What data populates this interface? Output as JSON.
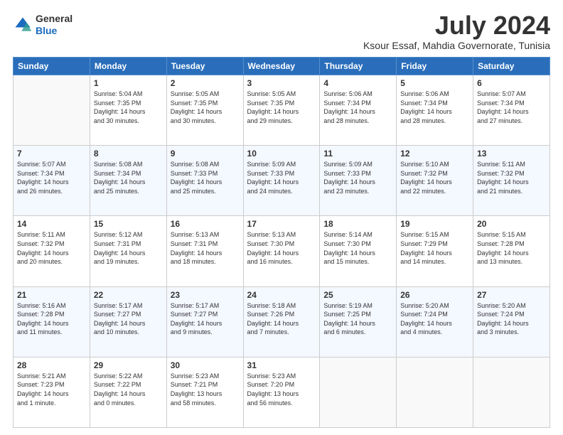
{
  "logo": {
    "general": "General",
    "blue": "Blue"
  },
  "header": {
    "month": "July 2024",
    "location": "Ksour Essaf, Mahdia Governorate, Tunisia"
  },
  "weekdays": [
    "Sunday",
    "Monday",
    "Tuesday",
    "Wednesday",
    "Thursday",
    "Friday",
    "Saturday"
  ],
  "weeks": [
    [
      {
        "day": "",
        "info": ""
      },
      {
        "day": "1",
        "info": "Sunrise: 5:04 AM\nSunset: 7:35 PM\nDaylight: 14 hours\nand 30 minutes."
      },
      {
        "day": "2",
        "info": "Sunrise: 5:05 AM\nSunset: 7:35 PM\nDaylight: 14 hours\nand 30 minutes."
      },
      {
        "day": "3",
        "info": "Sunrise: 5:05 AM\nSunset: 7:35 PM\nDaylight: 14 hours\nand 29 minutes."
      },
      {
        "day": "4",
        "info": "Sunrise: 5:06 AM\nSunset: 7:34 PM\nDaylight: 14 hours\nand 28 minutes."
      },
      {
        "day": "5",
        "info": "Sunrise: 5:06 AM\nSunset: 7:34 PM\nDaylight: 14 hours\nand 28 minutes."
      },
      {
        "day": "6",
        "info": "Sunrise: 5:07 AM\nSunset: 7:34 PM\nDaylight: 14 hours\nand 27 minutes."
      }
    ],
    [
      {
        "day": "7",
        "info": "Sunrise: 5:07 AM\nSunset: 7:34 PM\nDaylight: 14 hours\nand 26 minutes."
      },
      {
        "day": "8",
        "info": "Sunrise: 5:08 AM\nSunset: 7:34 PM\nDaylight: 14 hours\nand 25 minutes."
      },
      {
        "day": "9",
        "info": "Sunrise: 5:08 AM\nSunset: 7:33 PM\nDaylight: 14 hours\nand 25 minutes."
      },
      {
        "day": "10",
        "info": "Sunrise: 5:09 AM\nSunset: 7:33 PM\nDaylight: 14 hours\nand 24 minutes."
      },
      {
        "day": "11",
        "info": "Sunrise: 5:09 AM\nSunset: 7:33 PM\nDaylight: 14 hours\nand 23 minutes."
      },
      {
        "day": "12",
        "info": "Sunrise: 5:10 AM\nSunset: 7:32 PM\nDaylight: 14 hours\nand 22 minutes."
      },
      {
        "day": "13",
        "info": "Sunrise: 5:11 AM\nSunset: 7:32 PM\nDaylight: 14 hours\nand 21 minutes."
      }
    ],
    [
      {
        "day": "14",
        "info": "Sunrise: 5:11 AM\nSunset: 7:32 PM\nDaylight: 14 hours\nand 20 minutes."
      },
      {
        "day": "15",
        "info": "Sunrise: 5:12 AM\nSunset: 7:31 PM\nDaylight: 14 hours\nand 19 minutes."
      },
      {
        "day": "16",
        "info": "Sunrise: 5:13 AM\nSunset: 7:31 PM\nDaylight: 14 hours\nand 18 minutes."
      },
      {
        "day": "17",
        "info": "Sunrise: 5:13 AM\nSunset: 7:30 PM\nDaylight: 14 hours\nand 16 minutes."
      },
      {
        "day": "18",
        "info": "Sunrise: 5:14 AM\nSunset: 7:30 PM\nDaylight: 14 hours\nand 15 minutes."
      },
      {
        "day": "19",
        "info": "Sunrise: 5:15 AM\nSunset: 7:29 PM\nDaylight: 14 hours\nand 14 minutes."
      },
      {
        "day": "20",
        "info": "Sunrise: 5:15 AM\nSunset: 7:28 PM\nDaylight: 14 hours\nand 13 minutes."
      }
    ],
    [
      {
        "day": "21",
        "info": "Sunrise: 5:16 AM\nSunset: 7:28 PM\nDaylight: 14 hours\nand 11 minutes."
      },
      {
        "day": "22",
        "info": "Sunrise: 5:17 AM\nSunset: 7:27 PM\nDaylight: 14 hours\nand 10 minutes."
      },
      {
        "day": "23",
        "info": "Sunrise: 5:17 AM\nSunset: 7:27 PM\nDaylight: 14 hours\nand 9 minutes."
      },
      {
        "day": "24",
        "info": "Sunrise: 5:18 AM\nSunset: 7:26 PM\nDaylight: 14 hours\nand 7 minutes."
      },
      {
        "day": "25",
        "info": "Sunrise: 5:19 AM\nSunset: 7:25 PM\nDaylight: 14 hours\nand 6 minutes."
      },
      {
        "day": "26",
        "info": "Sunrise: 5:20 AM\nSunset: 7:24 PM\nDaylight: 14 hours\nand 4 minutes."
      },
      {
        "day": "27",
        "info": "Sunrise: 5:20 AM\nSunset: 7:24 PM\nDaylight: 14 hours\nand 3 minutes."
      }
    ],
    [
      {
        "day": "28",
        "info": "Sunrise: 5:21 AM\nSunset: 7:23 PM\nDaylight: 14 hours\nand 1 minute."
      },
      {
        "day": "29",
        "info": "Sunrise: 5:22 AM\nSunset: 7:22 PM\nDaylight: 14 hours\nand 0 minutes."
      },
      {
        "day": "30",
        "info": "Sunrise: 5:23 AM\nSunset: 7:21 PM\nDaylight: 13 hours\nand 58 minutes."
      },
      {
        "day": "31",
        "info": "Sunrise: 5:23 AM\nSunset: 7:20 PM\nDaylight: 13 hours\nand 56 minutes."
      },
      {
        "day": "",
        "info": ""
      },
      {
        "day": "",
        "info": ""
      },
      {
        "day": "",
        "info": ""
      }
    ]
  ]
}
